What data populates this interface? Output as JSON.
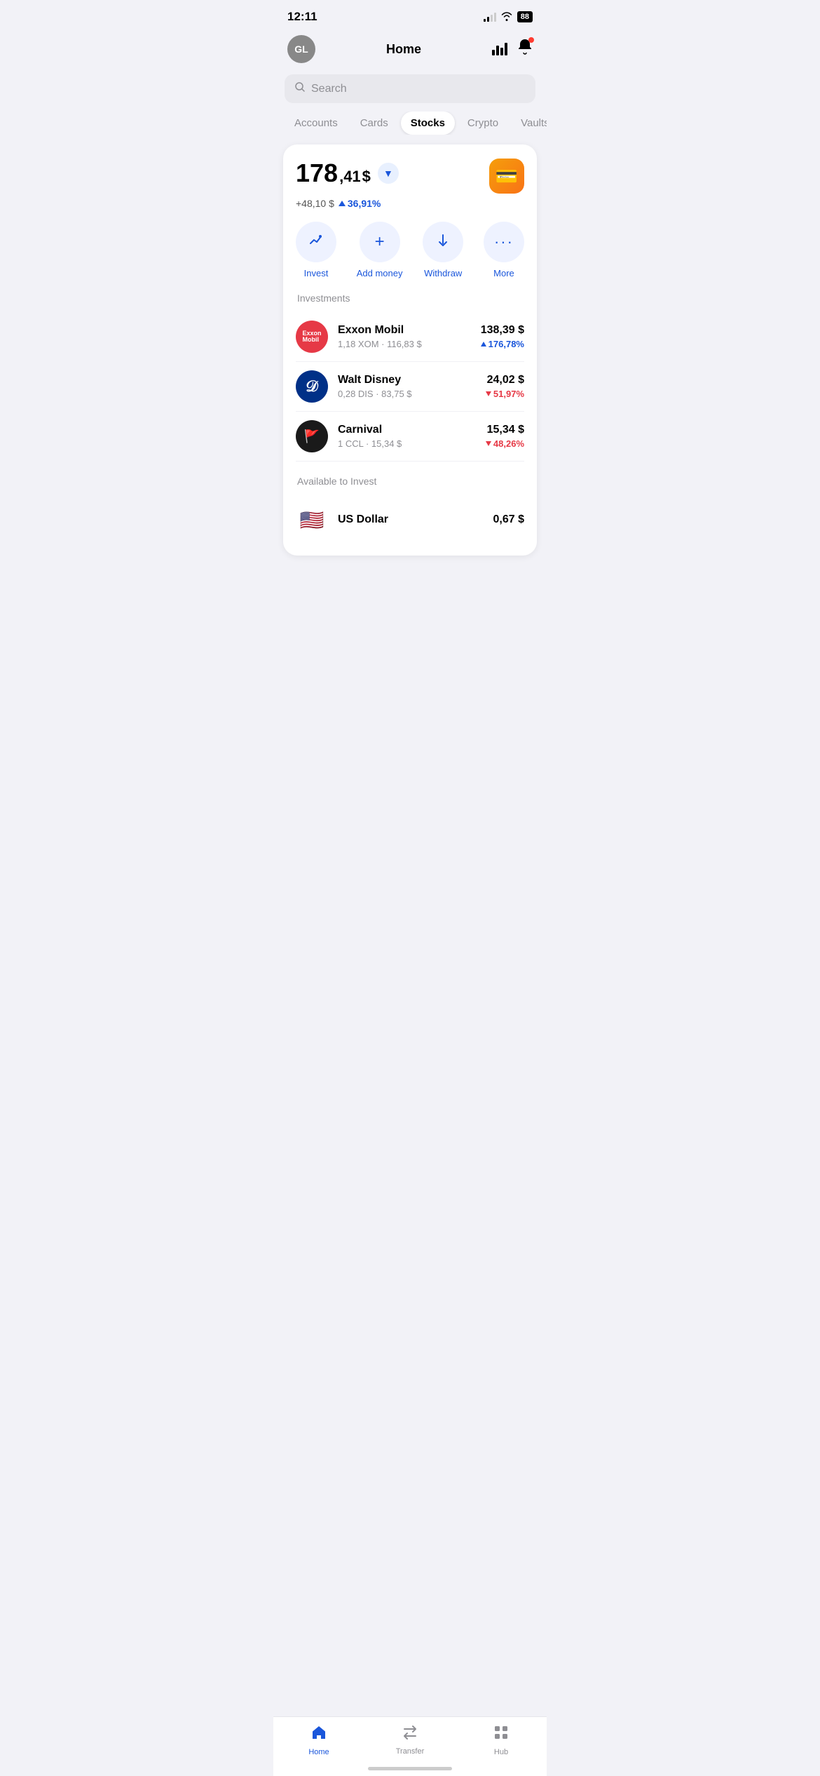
{
  "statusBar": {
    "time": "12:11",
    "battery": "88"
  },
  "header": {
    "avatarInitials": "GL",
    "title": "Home"
  },
  "search": {
    "placeholder": "Search"
  },
  "tabs": [
    {
      "id": "accounts",
      "label": "Accounts",
      "active": false
    },
    {
      "id": "cards",
      "label": "Cards",
      "active": false
    },
    {
      "id": "stocks",
      "label": "Stocks",
      "active": true
    },
    {
      "id": "crypto",
      "label": "Crypto",
      "active": false
    },
    {
      "id": "vaults",
      "label": "Vaults",
      "active": false
    }
  ],
  "portfolio": {
    "balanceInt": "178",
    "balanceDec": ",41",
    "balanceCurrency": "$",
    "changeAmount": "+48,10 $",
    "changePct": "36,91%"
  },
  "actions": [
    {
      "id": "invest",
      "label": "Invest",
      "icon": "chart"
    },
    {
      "id": "add-money",
      "label": "Add money",
      "icon": "plus"
    },
    {
      "id": "withdraw",
      "label": "Withdraw",
      "icon": "down"
    },
    {
      "id": "more",
      "label": "More",
      "icon": "dots"
    }
  ],
  "investmentsSectionLabel": "Investments",
  "investments": [
    {
      "id": "exxon",
      "name": "Exxon Mobil",
      "meta": "1,18 XOM · 116,83 $",
      "price": "138,39 $",
      "change": "176,78%",
      "changeType": "positive"
    },
    {
      "id": "disney",
      "name": "Walt Disney",
      "meta": "0,28 DIS · 83,75 $",
      "price": "24,02 $",
      "change": "51,97%",
      "changeType": "negative"
    },
    {
      "id": "carnival",
      "name": "Carnival",
      "meta": "1 CCL · 15,34 $",
      "price": "15,34 $",
      "change": "48,26%",
      "changeType": "negative"
    }
  ],
  "availableSectionLabel": "Available to Invest",
  "availableItems": [
    {
      "id": "usdollar",
      "name": "US Dollar",
      "amount": "0,67 $",
      "flag": "🇺🇸"
    }
  ],
  "bottomNav": [
    {
      "id": "home",
      "label": "Home",
      "active": true
    },
    {
      "id": "transfer",
      "label": "Transfer",
      "active": false
    },
    {
      "id": "hub",
      "label": "Hub",
      "active": false
    }
  ]
}
